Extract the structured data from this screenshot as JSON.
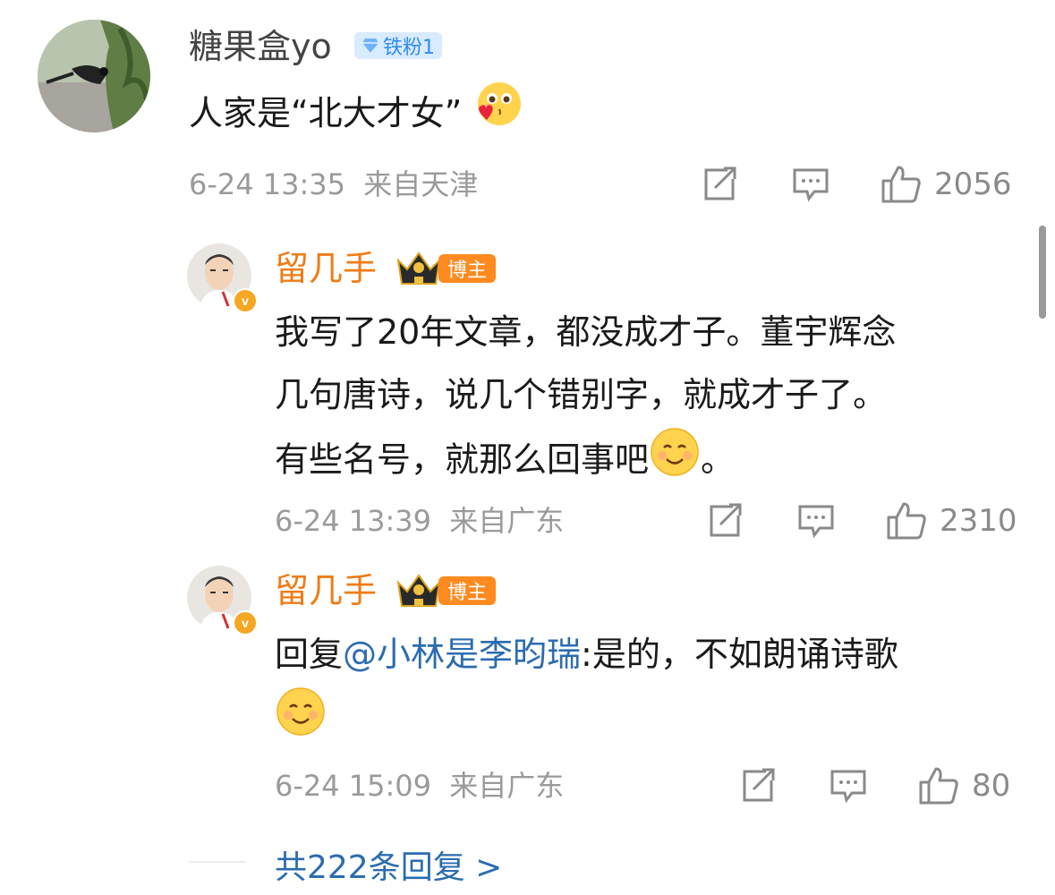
{
  "comment": {
    "username": "糖果盒yo",
    "badge": "铁粉1",
    "text": "人家是“北大才女”",
    "time": "6-24 13:35",
    "location": "来自天津",
    "likes": "2056"
  },
  "replies": [
    {
      "username": "留几手",
      "badge": "博主",
      "line1": "我写了20年文章，都没成才子。董宇辉念",
      "line2": "几句唐诗，说几个错别字，就成才子了。",
      "line3": "有些名号，就那么回事吧",
      "line3_end": "。",
      "time": "6-24 13:39",
      "location": "来自广东",
      "likes": "2310"
    },
    {
      "username": "留几手",
      "badge": "博主",
      "reply_prefix": "回复",
      "mention": "@小林是李昀瑞",
      "reply_text": ":是的，不如朗诵诗歌",
      "time": "6-24 15:09",
      "location": "来自广东",
      "likes": "80"
    }
  ],
  "more_replies": "共222条回复 >",
  "colors": {
    "orange_name": "#f07b14",
    "link_blue": "#2b6cb0",
    "meta_gray": "#9a9a9a",
    "badge_orange": "#ff8a1f"
  },
  "icons": [
    "repost-icon",
    "comment-icon",
    "like-icon",
    "heart-eyes-emoji",
    "smile-emoji",
    "verified-v-icon",
    "crown-icon",
    "diamond-icon"
  ]
}
